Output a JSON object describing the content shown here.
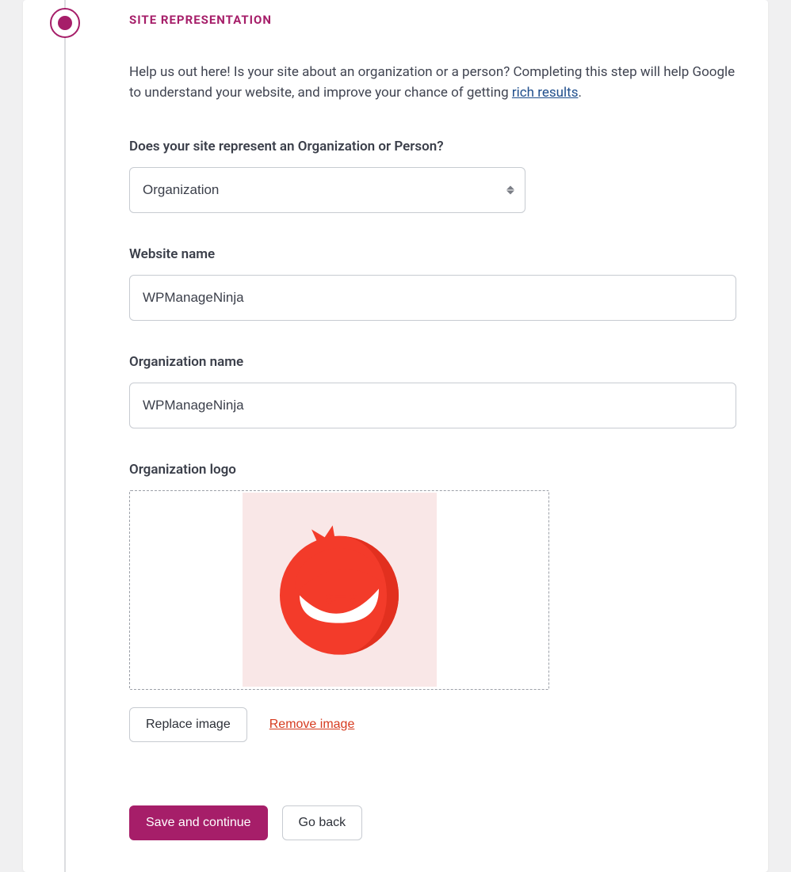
{
  "section": {
    "title": "SITE REPRESENTATION",
    "intro_prefix": "Help us out here! Is your site about an organization or a person? Completing this step will help Google to understand your website, and improve your chance of getting ",
    "intro_link": "rich results",
    "intro_suffix": "."
  },
  "fields": {
    "type": {
      "label": "Does your site represent an Organization or Person?",
      "value": "Organization"
    },
    "website_name": {
      "label": "Website name",
      "value": "WPManageNinja"
    },
    "org_name": {
      "label": "Organization name",
      "value": "WPManageNinja"
    },
    "org_logo": {
      "label": "Organization logo",
      "replace_label": "Replace image",
      "remove_label": "Remove image",
      "icon": "ninja-logo"
    }
  },
  "actions": {
    "save": "Save and continue",
    "back": "Go back"
  },
  "colors": {
    "brand": "#a61e69",
    "link": "#1f4e8c",
    "danger": "#d63b1f",
    "logo_red": "#f33b2a"
  }
}
